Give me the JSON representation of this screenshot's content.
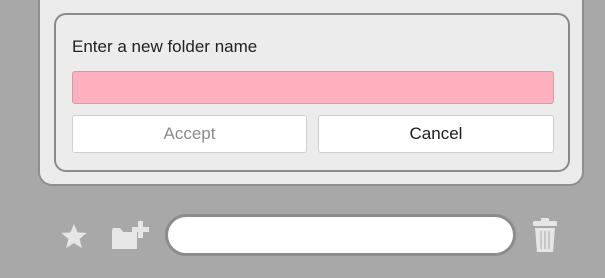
{
  "dialog": {
    "prompt": "Enter a new folder name",
    "input_value": "",
    "input_placeholder": "",
    "accept_label": "Accept",
    "cancel_label": "Cancel"
  },
  "toolbar": {
    "icons": [
      "star-icon",
      "new-folder-icon",
      "trash-icon"
    ],
    "field_value": ""
  },
  "colors": {
    "background": "#a8a8a8",
    "panel": "#ebebeb",
    "invalid_input": "#ffb0bf",
    "accept_disabled_text": "#8c8c8c"
  }
}
